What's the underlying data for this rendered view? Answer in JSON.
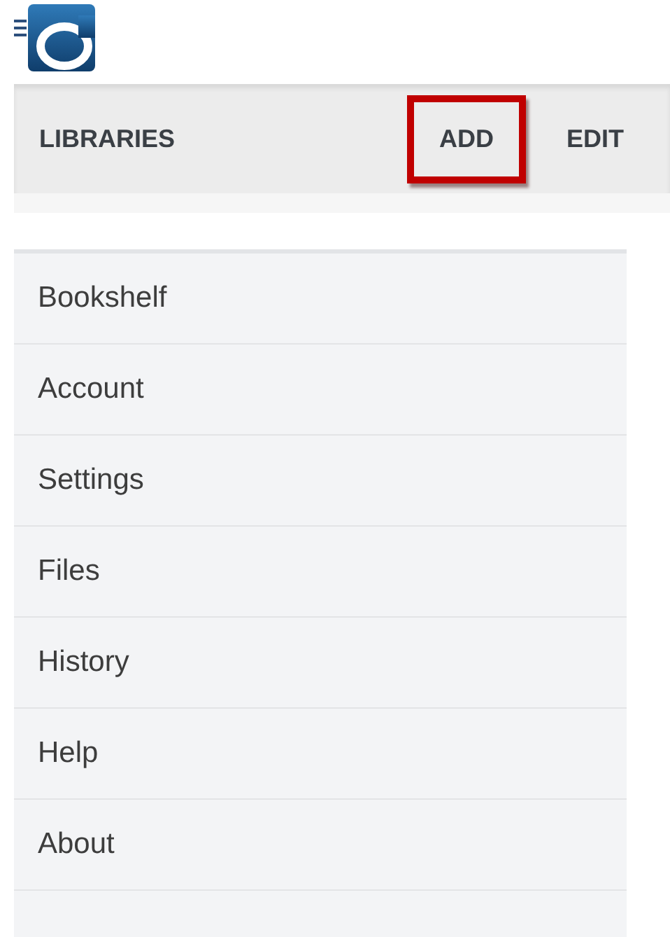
{
  "toolbar": {
    "title": "LIBRARIES",
    "actions": [
      {
        "label": "ADD",
        "highlighted": true
      },
      {
        "label": "EDIT",
        "highlighted": false
      }
    ]
  },
  "menu": {
    "items": [
      {
        "label": "Bookshelf"
      },
      {
        "label": "Account"
      },
      {
        "label": "Settings"
      },
      {
        "label": "Files"
      },
      {
        "label": "History"
      },
      {
        "label": "Help"
      },
      {
        "label": "About"
      }
    ]
  }
}
